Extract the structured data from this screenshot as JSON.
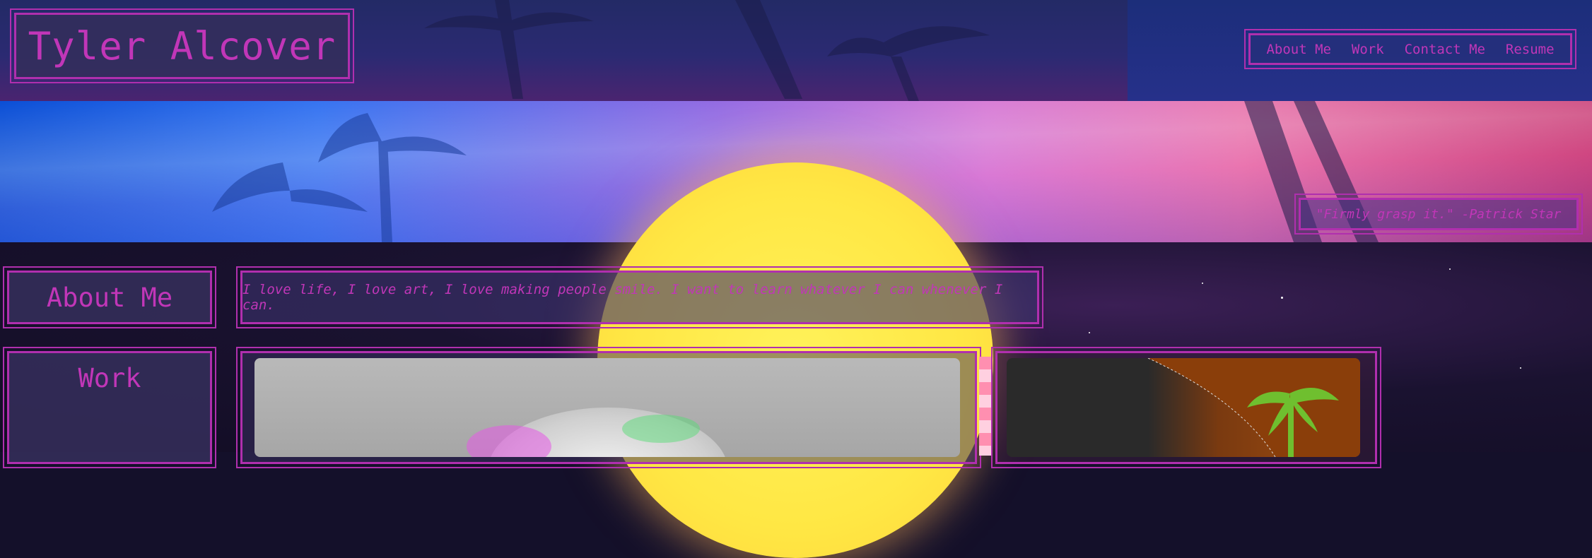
{
  "header": {
    "site_title": "Tyler Alcover",
    "nav": [
      "About Me",
      "Work",
      "Contact Me",
      "Resume"
    ]
  },
  "hero": {
    "quote": "\"Firmly grasp it.\" -Patrick Star"
  },
  "about": {
    "heading": "About Me",
    "text": "I love life, I love art, I love making people smile. I want to learn whatever I can whenever I can."
  },
  "work": {
    "heading": "Work"
  },
  "colors": {
    "accent": "#c136b8",
    "panel_bg": "#342e5a",
    "sun": "#ffe744"
  }
}
